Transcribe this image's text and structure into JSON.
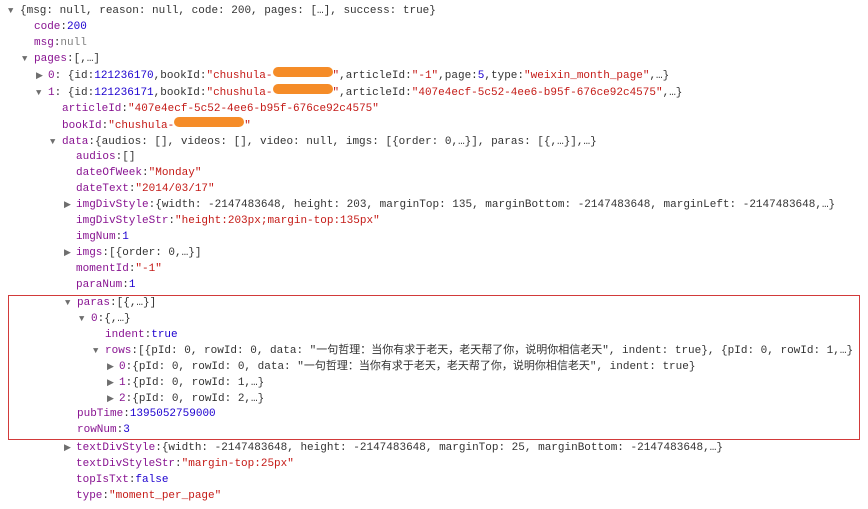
{
  "root": {
    "summary_open": "{",
    "summary_fields": "msg: null, reason: null, code: 200, pages: […], success: true",
    "summary_close": "}"
  },
  "code": {
    "key": "code",
    "value": "200"
  },
  "msg": {
    "key": "msg",
    "value": "null"
  },
  "pagesKey": "pages",
  "pagesPreview": "[,…]",
  "page0": {
    "key": "0",
    "id_label": "id",
    "id_value": "121236170",
    "bookId_label": "bookId",
    "bookId_prefix": "\"chushula-",
    "articleId_label": "articleId",
    "articleId_value": "\"-1\"",
    "page_label": "page",
    "page_value": "5",
    "type_label": "type",
    "type_value": "\"weixin_month_page\""
  },
  "page1": {
    "key": "1",
    "id_label": "id",
    "id_value": "121236171",
    "bookId_label": "bookId",
    "bookId_prefix": "\"chushula-",
    "articleId_label": "articleId",
    "articleId_value": "\"407e4ecf-5c52-4ee6-b95f-676ce92c4575\""
  },
  "articleId": {
    "key": "articleId",
    "value": "\"407e4ecf-5c52-4ee6-b95f-676ce92c4575\""
  },
  "bookId": {
    "key": "bookId",
    "prefix": "\"chushula-"
  },
  "data": {
    "key": "data",
    "preview": "{audios: [], videos: [], video: null, imgs: [{order: 0,…}], paras: [{,…}],…}"
  },
  "audios": {
    "key": "audios",
    "value": "[]"
  },
  "dateOfWeek": {
    "key": "dateOfWeek",
    "value": "\"Monday\""
  },
  "dateText": {
    "key": "dateText",
    "value": "\"2014/03/17\""
  },
  "imgDivStyle": {
    "key": "imgDivStyle",
    "preview": "{width: -2147483648, height: 203, marginTop: 135, marginBottom: -2147483648, marginLeft: -2147483648,…}"
  },
  "imgDivStyleStr": {
    "key": "imgDivStyleStr",
    "value": "\"height:203px;margin-top:135px\""
  },
  "imgNum": {
    "key": "imgNum",
    "value": "1"
  },
  "imgs": {
    "key": "imgs",
    "preview": "[{order: 0,…}]"
  },
  "momentId": {
    "key": "momentId",
    "value": "\"-1\""
  },
  "paraNum": {
    "key": "paraNum",
    "value": "1"
  },
  "paras": {
    "key": "paras",
    "preview": "[{,…}]"
  },
  "para0": {
    "key": "0",
    "preview": "{,…}"
  },
  "indent": {
    "key": "indent",
    "value": "true"
  },
  "rows": {
    "key": "rows",
    "preview": "[{pId: 0, rowId: 0, data: \"一句哲理：当你有求于老天，老天帮了你，说明你相信老天\", indent: true}, {pId: 0, rowId: 1,…}"
  },
  "row0": {
    "key": "0",
    "preview": "{pId: 0, rowId: 0, data: \"一句哲理：当你有求于老天，老天帮了你，说明你相信老天\", indent: true}"
  },
  "row1": {
    "key": "1",
    "preview": "{pId: 0, rowId: 1,…}"
  },
  "row2": {
    "key": "2",
    "preview": "{pId: 0, rowId: 2,…}"
  },
  "pubTime": {
    "key": "pubTime",
    "value": "1395052759000"
  },
  "rowNum": {
    "key": "rowNum",
    "value": "3"
  },
  "textDivStyle": {
    "key": "textDivStyle",
    "preview": "{width: -2147483648, height: -2147483648, marginTop: 25, marginBottom: -2147483648,…}"
  },
  "textDivStyleStr": {
    "key": "textDivStyleStr",
    "value": "\"margin-top:25px\""
  },
  "topIsTxt": {
    "key": "topIsTxt",
    "value": "false"
  },
  "type": {
    "key": "type",
    "value": "\"moment_per_page\""
  }
}
